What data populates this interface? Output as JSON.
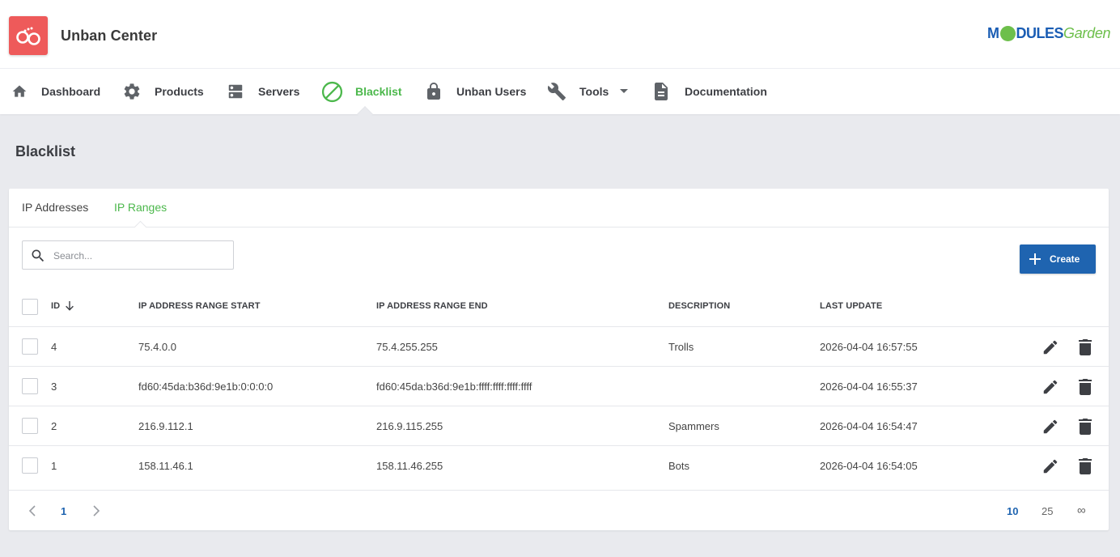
{
  "header": {
    "app_title": "Unban Center",
    "brand": {
      "part1": "M",
      "part2": "DULES",
      "part3": "Garden"
    },
    "accent_color": "#ee5a5a"
  },
  "nav": {
    "items": [
      {
        "label": "Dashboard",
        "icon": "home-icon"
      },
      {
        "label": "Products",
        "icon": "gear-icon"
      },
      {
        "label": "Servers",
        "icon": "server-icon"
      },
      {
        "label": "Blacklist",
        "icon": "block-icon",
        "active": true
      },
      {
        "label": "Unban Users",
        "icon": "lock-icon"
      },
      {
        "label": "Tools",
        "icon": "wrench-icon"
      },
      {
        "label": "Documentation",
        "icon": "document-icon"
      }
    ],
    "active_color": "#4cb84c"
  },
  "page": {
    "title": "Blacklist"
  },
  "tabs": {
    "items": [
      {
        "label": "IP Addresses"
      },
      {
        "label": "IP Ranges",
        "active": true
      }
    ]
  },
  "search": {
    "placeholder": "Search...",
    "value": ""
  },
  "create_button": {
    "label": "Create",
    "color": "#1f64b0"
  },
  "table": {
    "columns": [
      "ID",
      "IP ADDRESS RANGE START",
      "IP ADDRESS RANGE END",
      "DESCRIPTION",
      "LAST UPDATE"
    ],
    "sort": {
      "column": "ID",
      "direction": "desc"
    },
    "rows": [
      {
        "id": "4",
        "start": "75.4.0.0",
        "end": "75.4.255.255",
        "description": "Trolls",
        "last_update": "2026-04-04 16:57:55"
      },
      {
        "id": "3",
        "start": "fd60:45da:b36d:9e1b:0:0:0:0",
        "end": "fd60:45da:b36d:9e1b:ffff:ffff:ffff:ffff",
        "description": "",
        "last_update": "2026-04-04 16:55:37"
      },
      {
        "id": "2",
        "start": "216.9.112.1",
        "end": "216.9.115.255",
        "description": "Spammers",
        "last_update": "2026-04-04 16:54:47"
      },
      {
        "id": "1",
        "start": "158.11.46.1",
        "end": "158.11.46.255",
        "description": "Bots",
        "last_update": "2026-04-04 16:54:05"
      }
    ]
  },
  "pagination": {
    "current_page": "1",
    "page_sizes": [
      "10",
      "25",
      "∞"
    ],
    "active_page_size": "10"
  }
}
